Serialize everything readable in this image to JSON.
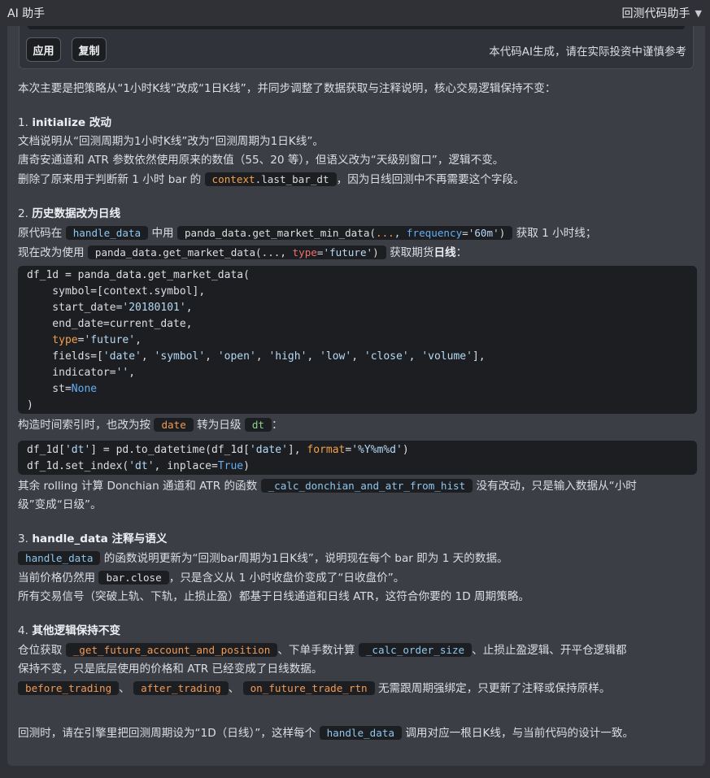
{
  "header": {
    "app_title": "AI 助手",
    "mode_label": "回测代码助手"
  },
  "actions": {
    "apply_label": "应用",
    "copy_label": "复制",
    "disclaimer": "本代码AI生成，请在实际投资中谨慎参考"
  },
  "intro": "本次主要是把策略从“1小时K线”改成“1日K线”，并同步调整了数据获取与注释说明，核心交易逻辑保持不变：",
  "s1": {
    "num": "1.",
    "title": "initialize 改动",
    "l1": "文档说明从“回测周期为1小时K线”改为“回测周期为1日K线”。",
    "l2": "唐奇安通道和 ATR 参数依然使用原来的数值（55、20 等），但语义改为“天级别窗口”，逻辑不变。",
    "l3a": "删除了原来用于判断新 1 小时 bar 的",
    "l3_code_kw": "context",
    "l3_code_rest": ".last_bar_dt",
    "l3b": "，因为日线回测中不再需要这个字段。"
  },
  "s2": {
    "num": "2.",
    "title": "历史数据改为日线",
    "l1a": "原代码在",
    "l1_code1": "handle_data",
    "l1b": "中用",
    "l1_code2a": "panda_data.get_market_min_data(",
    "l1_code2dots": "...",
    "l1_code2b": ", ",
    "l1_code2kw": "frequency",
    "l1_code2c": "=",
    "l1_code2str": "'60m'",
    "l1_code2d": ")",
    "l1c": "获取 1 小时线；",
    "l2a": "现在改为使用",
    "l2_code_a": "panda_data.get_market_data(..., ",
    "l2_code_kw": "type",
    "l2_code_eq": "=",
    "l2_code_str": "'future'",
    "l2_code_end": ")",
    "l2b": "获取期货",
    "l2b_bold": "日线",
    "l2c": "：",
    "code": {
      "l1": "df_1d = panda_data.get_market_data(",
      "l2": "    symbol=[context.symbol],",
      "l3a": "    start_date=",
      "l3s": "'20180101'",
      "l3b": ",",
      "l4": "    end_date=current_date,",
      "l5kw": "    type",
      "l5eq": "=",
      "l5s": "'future'",
      "l5b": ",",
      "l6a": "    fields=[",
      "l6s1": "'date'",
      "l6s2": "'symbol'",
      "l6s3": "'open'",
      "l6s4": "'high'",
      "l6s5": "'low'",
      "l6s6": "'close'",
      "l6s7": "'volume'",
      "l6sep": ", ",
      "l6b": "],",
      "l7a": "    indicator=",
      "l7s": "''",
      "l7b": ",",
      "l8a": "    st=",
      "l8n": "None",
      "l9": ")"
    },
    "l3a": "构造时间索引时，也改为按",
    "l3_code1": "date",
    "l3b": "转为日级",
    "l3_code2": "dt",
    "l3c": "：",
    "code2": {
      "l1a": "df_1d[",
      "l1s1": "'dt'",
      "l1b": "] = pd.to_datetime(df_1d[",
      "l1s2": "'date'",
      "l1c": "], ",
      "l1kw": "format",
      "l1eq": "=",
      "l1s3": "'%Y%m%d'",
      "l1d": ")",
      "l2a": "df_1d.set_index(",
      "l2s": "'dt'",
      "l2b": ", inplace=",
      "l2n": "True",
      "l2c": ")"
    },
    "l4a": "其余 rolling 计算 Donchian 通道和 ATR 的函数",
    "l4_code": "_calc_donchian_and_atr_from_hist",
    "l4b": "没有改动，只是输入数据从“小时",
    "l4c": "级”变成“日级”。"
  },
  "s3": {
    "num": "3.",
    "title": "handle_data 注释与语义",
    "l1_code": "handle_data",
    "l1": "的函数说明更新为“回测bar周期为1日K线”，说明现在每个 bar 即为 1 天的数据。",
    "l2a": "当前价格仍然用",
    "l2_code": "bar.close",
    "l2b": "，只是含义从 1 小时收盘价变成了“日收盘价”。",
    "l3": "所有交易信号（突破上轨、下轨，止损止盈）都基于日线通道和日线 ATR，这符合你要的 1D 周期策略。"
  },
  "s4": {
    "num": "4.",
    "title": "其他逻辑保持不变",
    "l1a": "仓位获取",
    "l1_code1": "_get_future_account_and_position",
    "l1b": "、下单手数计算",
    "l1_code2": "_calc_order_size",
    "l1c": "、止损止盈逻辑、开平仓逻辑都",
    "l2": "保持不变，只是底层使用的价格和 ATR 已经变成了日线数据。",
    "l3_code1": "before_trading",
    "l3_sep": "、",
    "l3_code2": "after_trading",
    "l3_code3": "on_future_trade_rtn",
    "l3b": "无需跟周期强绑定，只更新了注释或保持原样。"
  },
  "outro": {
    "a": "回测时，请在引擎里把回测周期设为“1D（日线）”，这样每个",
    "code": "handle_data",
    "b": "调用对应一根日K线，与当前代码的设计一致。"
  }
}
